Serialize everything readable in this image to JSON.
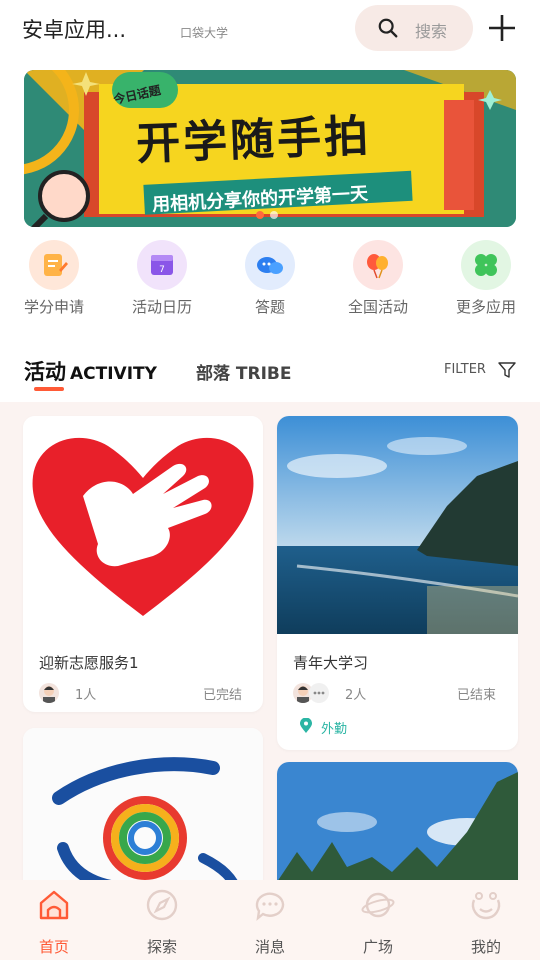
{
  "header": {
    "app_title": "安卓应用...",
    "school": "口袋大学",
    "search_placeholder": "搜索"
  },
  "banner": {
    "topic": "今日话题",
    "title": "开学随手拍",
    "subtitle": "用相机分享你的开学第一天",
    "page_count": 2,
    "active_page": 1
  },
  "shortcuts": [
    {
      "label": "学分申请",
      "icon": "credit-apply-icon",
      "color": "#ffe7d9"
    },
    {
      "label": "活动日历",
      "icon": "calendar-icon",
      "color": "#f1e3fb"
    },
    {
      "label": "答题",
      "icon": "quiz-chat-icon",
      "color": "#e2ecfd"
    },
    {
      "label": "全国活动",
      "icon": "balloon-icon",
      "color": "#fde4e2"
    },
    {
      "label": "更多应用",
      "icon": "clover-icon",
      "color": "#e2f6e3"
    }
  ],
  "tabs": {
    "activity_cn": "活动",
    "activity_en": "ACTIVITY",
    "tribe": "部落 TRIBE",
    "filter": "FILTER"
  },
  "cards": [
    {
      "title": "迎新志愿服务1",
      "count": "1人",
      "status": "已完结"
    },
    {
      "title": "青年大学习",
      "count": "2人",
      "status": "已结束",
      "location": "外勤"
    }
  ],
  "nav": [
    {
      "label": "首页",
      "icon": "home-icon",
      "active": true
    },
    {
      "label": "探索",
      "icon": "compass-icon",
      "active": false
    },
    {
      "label": "消息",
      "icon": "message-icon",
      "active": false
    },
    {
      "label": "广场",
      "icon": "planet-icon",
      "active": false
    },
    {
      "label": "我的",
      "icon": "profile-icon",
      "active": false
    }
  ],
  "colors": {
    "accent": "#ff5a36",
    "feed_bg": "#fbf3f1",
    "location": "#2bb5a4"
  }
}
